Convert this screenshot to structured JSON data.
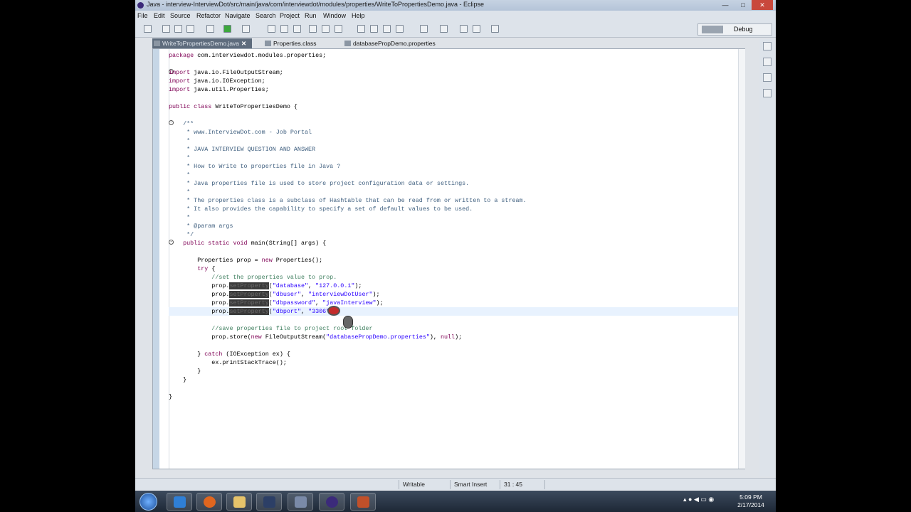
{
  "window": {
    "title": "Java - interview-InterviewDot/src/main/java/com/interviewdot/modules/properties/WriteToPropertiesDemo.java - Eclipse",
    "minimize": "—",
    "maximize": "□",
    "close": "✕"
  },
  "menu": [
    "File",
    "Edit",
    "Source",
    "Refactor",
    "Navigate",
    "Search",
    "Project",
    "Run",
    "Window",
    "Help"
  ],
  "toolbar": {
    "perspective_java": "Java",
    "perspective_debug": "Debug"
  },
  "tabs": [
    {
      "label": "WriteToPropertiesDemo.java",
      "close": "✕"
    },
    {
      "label": "Properties.class"
    },
    {
      "label": "databasePropDemo.properties"
    }
  ],
  "code": {
    "lines": [
      "package com.interviewdot.modules.properties;",
      "",
      "import java.io.FileOutputStream;",
      "import java.io.IOException;",
      "import java.util.Properties;",
      "",
      "public class WriteToPropertiesDemo {",
      "",
      "    /**",
      "     * www.InterviewDot.com - Job Portal",
      "     *",
      "     * JAVA INTERVIEW QUESTION AND ANSWER",
      "     *",
      "     * How to Write to properties file in Java ?",
      "     *",
      "     * Java properties file is used to store project configuration data or settings.",
      "     *",
      "     * The properties class is a subclass of Hashtable that can be read from or written to a stream.",
      "     * It also provides the capability to specify a set of default values to be used.",
      "     *",
      "     * @param args",
      "     */",
      "    public static void main(String[] args) {",
      "",
      "        Properties prop = new Properties();",
      "        try {",
      "            //set the properties value to prop.",
      "            prop.setProperty(\"database\", \"127.0.0.1\");",
      "            prop.setProperty(\"dbuser\", \"interviewDotUser\");",
      "            prop.setProperty(\"dbpassword\", \"javaInterview\");",
      "            prop.setProperty(\"dbport\", \"3306\");",
      "",
      "            //save properties file to project root folder",
      "            prop.store(new FileOutputStream(\"databasePropDemo.properties\"), null);",
      "",
      "        } catch (IOException ex) {",
      "            ex.printStackTrace();",
      "        }",
      "    }",
      "",
      "}"
    ]
  },
  "status": {
    "writable": "Writable",
    "insert_mode": "Smart Insert",
    "position": "31 : 45"
  },
  "taskbar": {
    "time": "5:09 PM",
    "date": "2/17/2014"
  },
  "colors": {
    "keyword": "#7f0055",
    "javadoc": "#3f5f7f",
    "comment": "#3f7f5f",
    "string": "#2a00ff",
    "current_line": "#e8f2fe",
    "active_tab": "#5e6c7d"
  }
}
